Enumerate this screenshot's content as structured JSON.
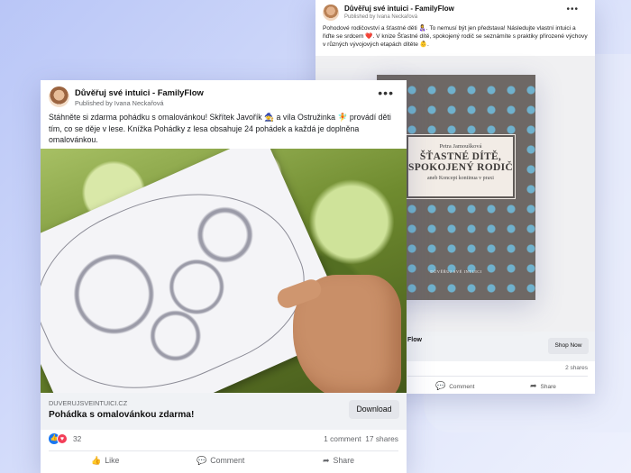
{
  "back_post": {
    "page_name": "Důvěřuj své intuici - FamilyFlow",
    "published_by": "Published by Ivana Neckařová",
    "text": "Pohodové rodičovství a šťastné děti 👩‍🍼. To nemusí být jen představa! Následujte vlastní intuici a řiďte se srdcem ❤️. V knize Šťastné dítě, spokojený rodič se seznámíte s praktiky přirozené výchovy v různých vývojových etapách dítěte 👶.",
    "book": {
      "author": "Petra Jamoušková",
      "title_line1": "ŠŤASTNÉ DÍTĚ,",
      "title_line2": "SPOKOJENÝ RODIČ",
      "subtitle": "aneb Koncept kontinua v praxi",
      "publisher": "DŮVĚŘUJ SVÉ INTUICI"
    },
    "link_name": "Flow",
    "shop_button": "Shop Now",
    "shares": "2 shares",
    "actions": {
      "comment": "Comment",
      "share": "Share"
    }
  },
  "front_post": {
    "page_name": "Důvěřuj své intuici - FamilyFlow",
    "published_by": "Published by Ivana Neckařová",
    "text": "Stáhněte si zdarma pohádku s omalovánkou! Skřítek Javořík 🧙 a víla Ostružinka 🧚 provádí děti tím, co se děje v lese. Knížka Pohádky z lesa obsahuje 24 pohádek a každá je doplněna omalovánkou.",
    "domain": "DUVERUJSVEINTUICI.CZ",
    "link_title": "Pohádka s omalovánkou zdarma!",
    "download_button": "Download",
    "reaction_count": "32",
    "comments": "1 comment",
    "shares": "17 shares",
    "actions": {
      "like": "Like",
      "comment": "Comment",
      "share": "Share"
    }
  },
  "icons": [
    "more-dots-icon",
    "like-icon",
    "comment-icon",
    "share-icon",
    "like-reaction-icon",
    "love-reaction-icon"
  ],
  "colors": {
    "accent": "#1877f2",
    "love": "#f33e58",
    "book_heart": "#6fb9d9",
    "book_cover": "#6e6865"
  }
}
